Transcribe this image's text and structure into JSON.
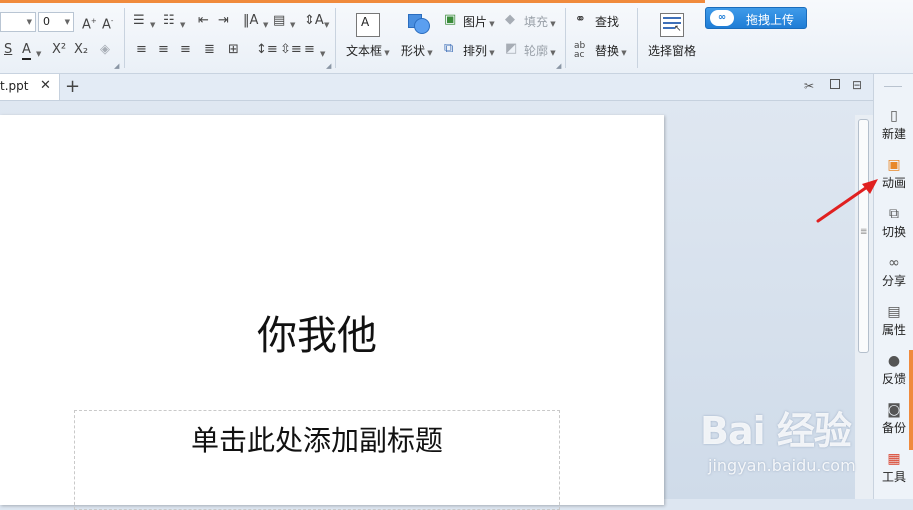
{
  "ribbon": {
    "font_size_value": "0",
    "insert_group": {
      "textbox": "文本框",
      "shape": "形状",
      "picture": "图片",
      "arrange": "排列",
      "fill": "填充",
      "outline": "轮廓"
    },
    "edit_group": {
      "find": "查找",
      "replace": "替换",
      "selection_pane": "选择窗格"
    },
    "upload_button": "拖拽上传",
    "upload_icon": "cloud-icon"
  },
  "tabs": {
    "doc_tab": "t.ppt",
    "new_tab": "+"
  },
  "slide": {
    "title": "你我他",
    "subtitle": "单击此处添加副标题"
  },
  "sidebar": {
    "items": [
      {
        "label": "新建",
        "icon": "new-doc-icon"
      },
      {
        "label": "动画",
        "icon": "animation-icon"
      },
      {
        "label": "切换",
        "icon": "transition-icon"
      },
      {
        "label": "分享",
        "icon": "share-link-icon"
      },
      {
        "label": "属性",
        "icon": "properties-icon"
      },
      {
        "label": "反馈",
        "icon": "feedback-icon"
      },
      {
        "label": "备份",
        "icon": "backup-icon"
      },
      {
        "label": "工具",
        "icon": "toolbox-icon"
      }
    ]
  },
  "watermark": {
    "logo": "Bai 经验",
    "url": "jingyan.baidu.com"
  },
  "colors": {
    "accent_orange": "#f08a3c",
    "annotation_red": "#e02020",
    "upload_blue": "#1f7dd6"
  }
}
